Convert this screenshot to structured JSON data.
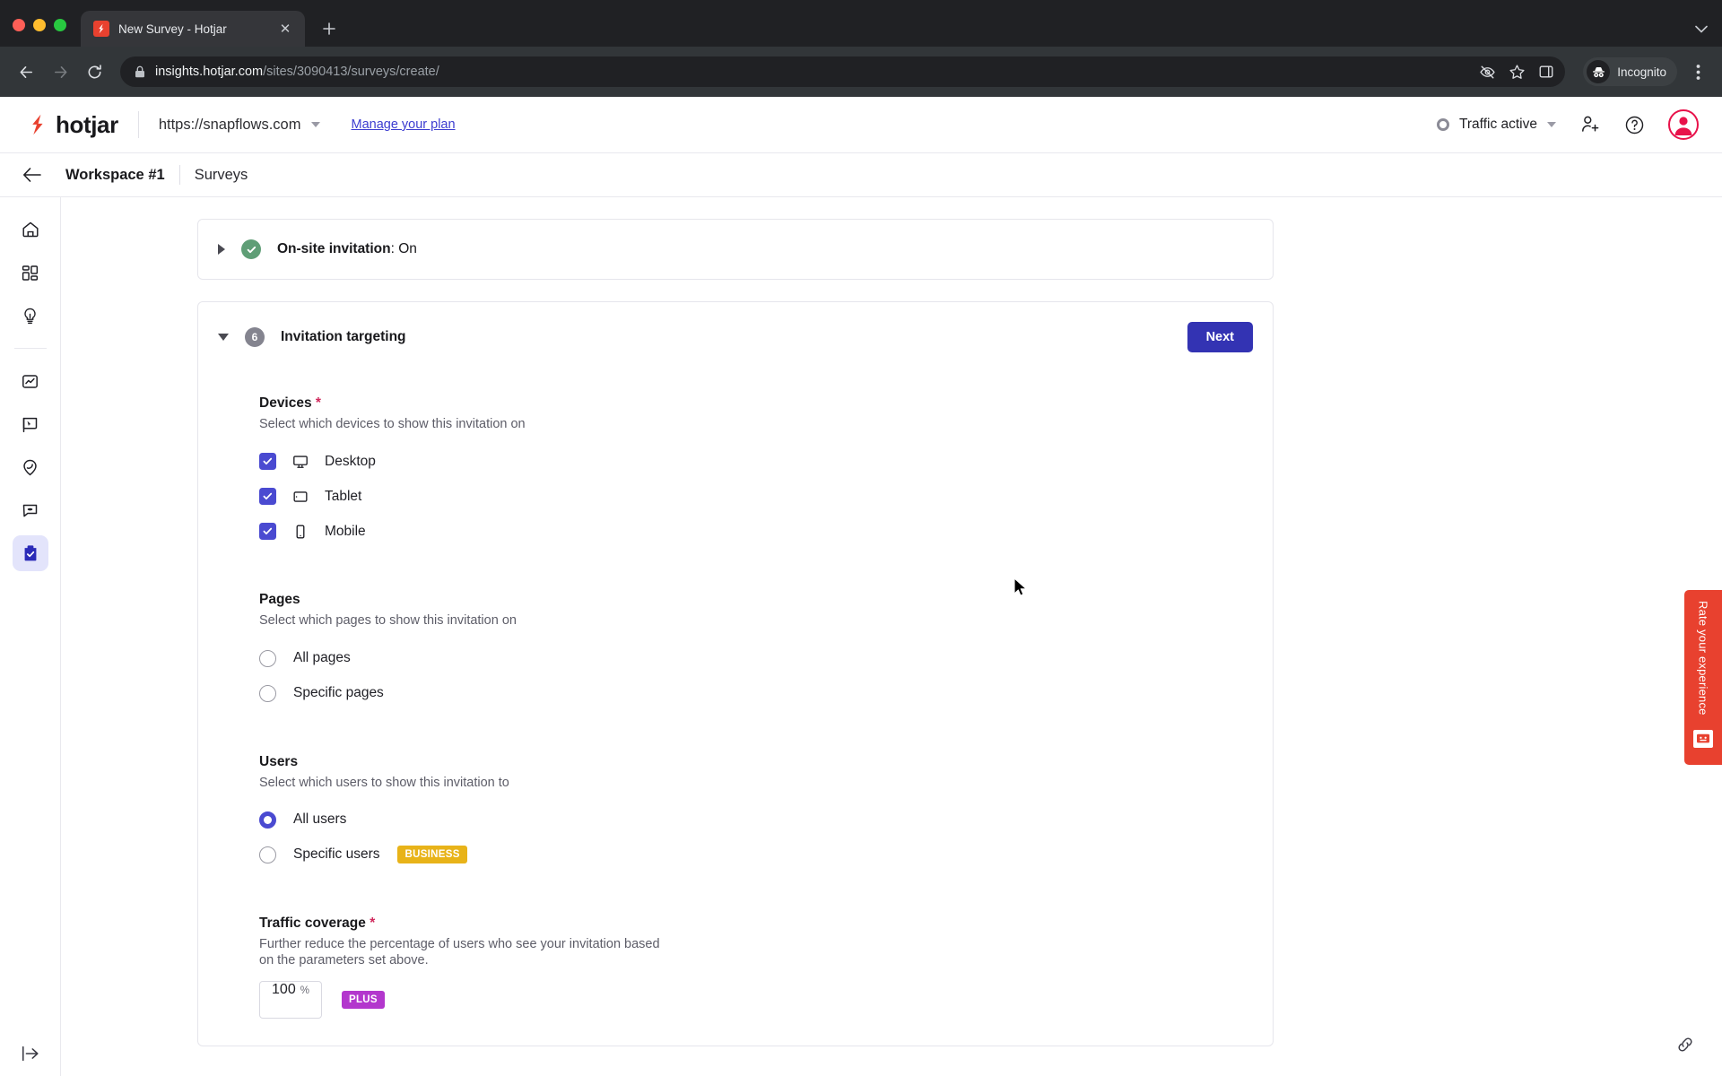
{
  "browser": {
    "tab": {
      "title": "New Survey - Hotjar",
      "favicon": "hotjar-favicon",
      "close": "✕"
    },
    "newtab_label": "+",
    "tabstrip_chevron": "⌄",
    "nav": {
      "back": "back-arrow",
      "forward": "forward-arrow",
      "reload": "reload-icon"
    },
    "omnibox": {
      "domain": "insights.hotjar.com",
      "path": "/sites/3090413/surveys/create/",
      "lock_icon": "lock-icon",
      "icons": [
        "eye-crossed-icon",
        "star-icon",
        "side-panel-icon"
      ]
    },
    "profile": {
      "label": "Incognito",
      "icon": "incognito-icon"
    },
    "menu_icon": "kebab-menu-icon"
  },
  "app_header": {
    "logo_text": "hotjar",
    "site_url": "https://snapflows.com",
    "site_caret": "chevron-down-icon",
    "manage_plan": "Manage your plan",
    "traffic_status": "Traffic active",
    "traffic_caret": "chevron-down-icon",
    "invite_icon": "add-user-icon",
    "help_icon": "help-circle-icon",
    "avatar_icon": "user-avatar-icon"
  },
  "breadcrumb": {
    "back_icon": "arrow-left-icon",
    "workspace": "Workspace #1",
    "section": "Surveys"
  },
  "sidebar": {
    "items": [
      {
        "name": "home",
        "icon": "home-icon",
        "active": false
      },
      {
        "name": "dashboard",
        "icon": "grid-icon",
        "active": false
      },
      {
        "name": "insights",
        "icon": "lightbulb-icon",
        "active": false
      },
      {
        "name": "trends",
        "icon": "chart-line-icon",
        "active": false
      },
      {
        "name": "heatmaps",
        "icon": "cursor-flag-icon",
        "active": false
      },
      {
        "name": "recordings",
        "icon": "location-pin-icon",
        "active": false
      },
      {
        "name": "feedback",
        "icon": "speech-bubble-icon",
        "active": false
      },
      {
        "name": "surveys",
        "icon": "clipboard-check-icon",
        "active": true
      }
    ],
    "collapse_icon": "collapse-panel-icon"
  },
  "cards": {
    "onsite": {
      "toggle_icon": "triangle-right-icon",
      "status_icon": "check-circle-icon",
      "title_bold": "On-site invitation",
      "title_rest": ": On"
    },
    "targeting": {
      "toggle_icon": "triangle-down-icon",
      "step_number": "6",
      "title": "Invitation targeting",
      "next_label": "Next",
      "next_color": "#3333b3",
      "devices": {
        "label": "Devices",
        "required": "*",
        "hint": "Select which devices to show this invitation on",
        "options": [
          {
            "label": "Desktop",
            "icon": "desktop-icon",
            "checked": true
          },
          {
            "label": "Tablet",
            "icon": "tablet-icon",
            "checked": true
          },
          {
            "label": "Mobile",
            "icon": "mobile-icon",
            "checked": true
          }
        ]
      },
      "pages": {
        "label": "Pages",
        "hint": "Select which pages to show this invitation on",
        "options": [
          {
            "label": "All pages",
            "selected": false
          },
          {
            "label": "Specific pages",
            "selected": false
          }
        ]
      },
      "users": {
        "label": "Users",
        "hint": "Select which users to show this invitation to",
        "options": [
          {
            "label": "All users",
            "selected": true,
            "badge": null
          },
          {
            "label": "Specific users",
            "selected": false,
            "badge": "BUSINESS"
          }
        ],
        "badge_color": "#e8b319"
      },
      "traffic_coverage": {
        "label": "Traffic coverage",
        "required": "*",
        "hint": "Further reduce the percentage of users who see your invitation based on the parameters set above.",
        "value": "100",
        "unit": "%",
        "badge": "PLUS",
        "badge_color": "#b337cd"
      }
    }
  },
  "feedback_widget": {
    "text": "Rate your experience",
    "icon": "feedback-face-icon",
    "color": "#e8412f"
  },
  "link_fab_icon": "link-icon"
}
